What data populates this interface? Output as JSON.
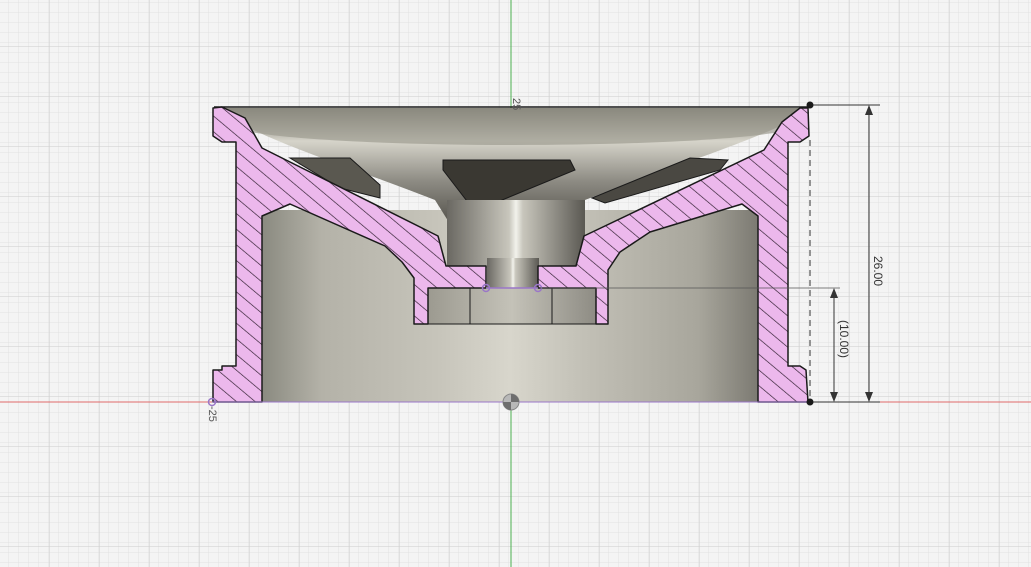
{
  "viewport": {
    "background": "#f4f4f4",
    "grid_minor_color": "#e2e2e2",
    "grid_major_color": "#cdcdcd",
    "x_axis_color": "#e06a6a",
    "y_axis_color": "#4caf50"
  },
  "model": {
    "section_fill": "#ecb8ec",
    "hatch_color": "#2a1a2a",
    "outline_color": "#1a1a1a",
    "metal_color": "#8c8a82",
    "sketch_color": "#9a76c8"
  },
  "dimensions": {
    "overall_height": "26.00",
    "reference_height": "(10.00)"
  },
  "coordinate_labels": {
    "top_marker": "25",
    "left_marker": "-25"
  },
  "icons": {
    "origin": "origin-icon"
  }
}
